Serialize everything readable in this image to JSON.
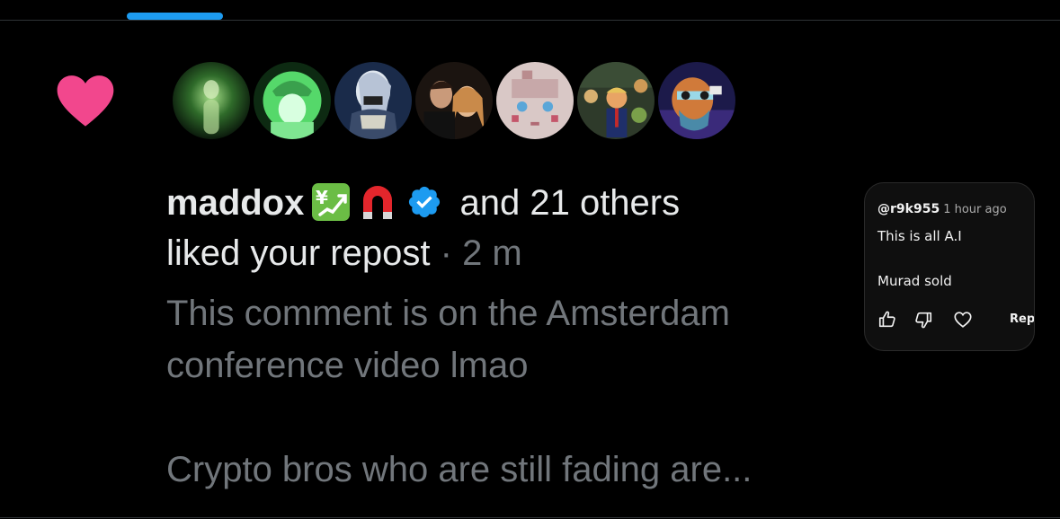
{
  "notification": {
    "type_icon": "heart-icon",
    "heart_color": "#f2478d",
    "avatars": [
      {
        "name": "avatar-1"
      },
      {
        "name": "avatar-2"
      },
      {
        "name": "avatar-3"
      },
      {
        "name": "avatar-4"
      },
      {
        "name": "avatar-5"
      },
      {
        "name": "avatar-6"
      },
      {
        "name": "avatar-7"
      }
    ],
    "user_name": "maddox",
    "name_emojis": [
      "chart-yen-emoji",
      "magnet-emoji"
    ],
    "verified_icon": "verified-badge-icon",
    "verified_color": "#1d9bf0",
    "others_text": "and 21 others",
    "action_text": "liked your repost",
    "separator": "·",
    "time": "2 m",
    "preview_line_1": "This comment is on the Amsterdam",
    "preview_line_2": "conference video lmao",
    "preview_line_3": "Crypto bros who are still fading are..."
  },
  "embedded_comment": {
    "handle": "@r9k955",
    "time": "1 hour ago",
    "line_1": "This is all A.I",
    "line_2": "Murad sold",
    "reply_label": "Repl",
    "icons": [
      "thumbs-up-icon",
      "thumbs-down-icon",
      "heart-outline-icon"
    ]
  },
  "tab": {
    "indicator_color": "#1d9bf0"
  }
}
